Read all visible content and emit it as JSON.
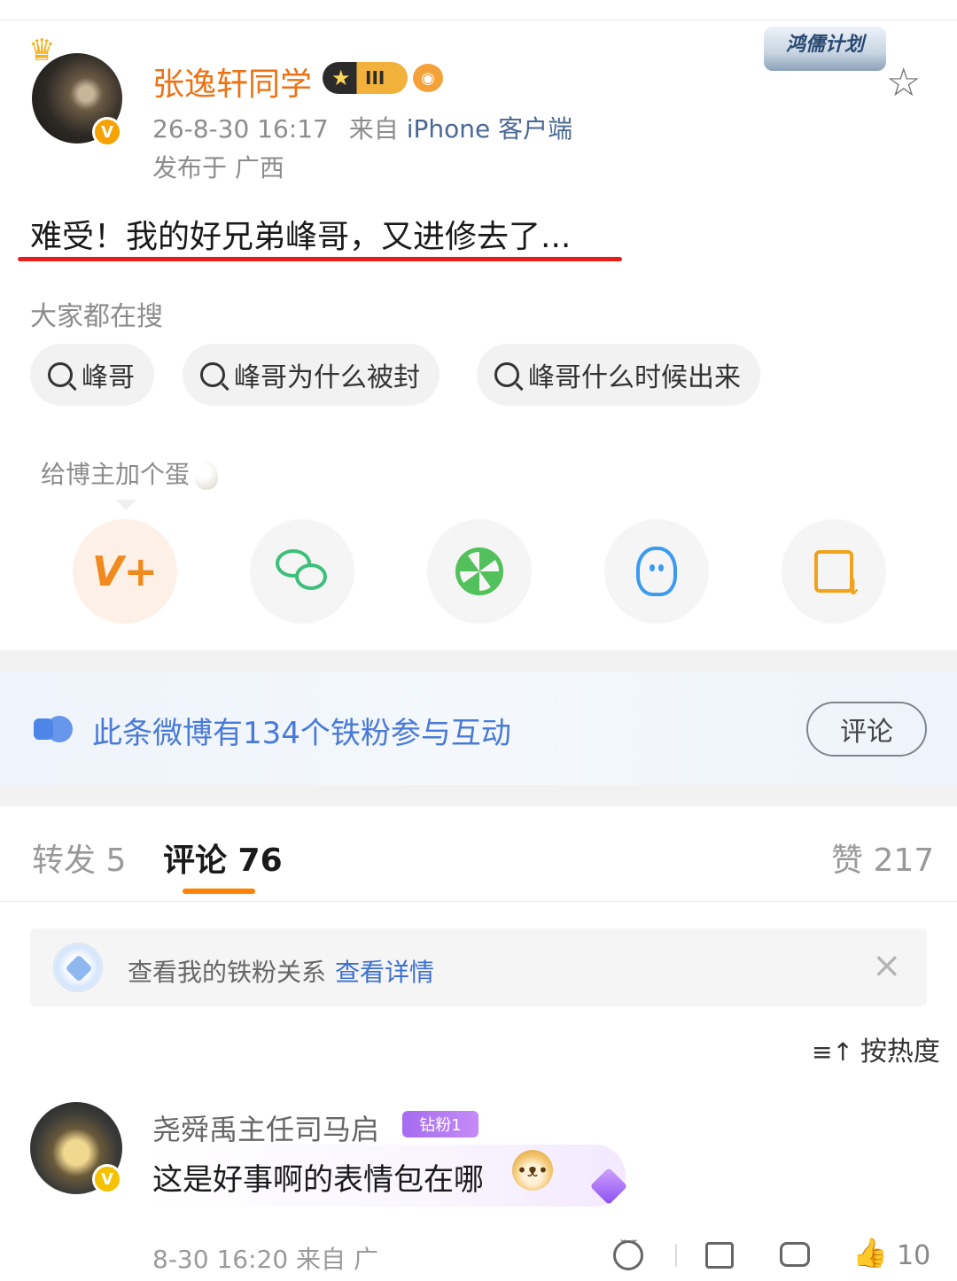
{
  "post": {
    "author": {
      "name": "张逸轩同学",
      "level_badge": "III",
      "verified": "V"
    },
    "timestamp": "26-8-30 16:17",
    "from_label": "来自",
    "source": "iPhone 客户端",
    "location": "发布于 广西",
    "plan_badge": "鸿儒计划",
    "text": "难受！我的好兄弟峰哥，又进修去了..."
  },
  "search": {
    "title": "大家都在搜",
    "chips": [
      "峰哥",
      "峰哥为什么被封",
      "峰哥什么时候出来"
    ]
  },
  "egg_tip": "给博主加个蛋",
  "share_buttons": [
    {
      "icon": "vplus-icon",
      "glyph": "V+"
    },
    {
      "icon": "wechat-icon"
    },
    {
      "icon": "moments-icon"
    },
    {
      "icon": "qq-icon"
    },
    {
      "icon": "save-image-icon"
    }
  ],
  "fan_banner": {
    "text": "此条微博有134个铁粉参与互动",
    "button": "评论"
  },
  "tabs": {
    "repost": "转发 5",
    "comment": "评论 76",
    "like": "赞 217"
  },
  "relation_bar": {
    "text": "查看我的铁粉关系",
    "link": "查看详情",
    "close": "×"
  },
  "sort": {
    "icon": "≡↑",
    "label": "按热度"
  },
  "comments": [
    {
      "author": "尧舜禹主任司马启",
      "badge": "钻粉1",
      "text": "这是好事啊的表情包在哪",
      "meta": "8-30 16:20 来自 广",
      "likes": "10",
      "verified": "V"
    }
  ],
  "colors": {
    "username": "#eb7316",
    "link": "#4a6893",
    "accent": "#ff8200",
    "underline": "#e51e1e",
    "fan_text": "#4a7ad9"
  }
}
